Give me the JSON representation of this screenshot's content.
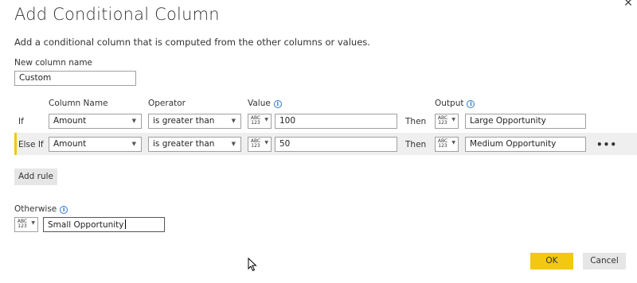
{
  "dialog": {
    "title": "Add Conditional Column",
    "description": "Add a conditional column that is computed from the other columns or values.",
    "close_glyph": "✕"
  },
  "new_column": {
    "label": "New column name",
    "value": "Custom"
  },
  "headers": {
    "column_name": "Column Name",
    "operator": "Operator",
    "value": "Value",
    "output": "Output"
  },
  "info_glyph": "i",
  "type_icon": {
    "top": "ABC",
    "bottom": "123"
  },
  "rules": [
    {
      "label": "If",
      "column": "Amount",
      "operator": "is greater than",
      "value": "100",
      "then": "Then",
      "output": "Large Opportunity"
    },
    {
      "label": "Else If",
      "column": "Amount",
      "operator": "is greater than",
      "value": "50",
      "then": "Then",
      "output": "Medium Opportunity",
      "more": "•••"
    }
  ],
  "add_rule": "Add rule",
  "otherwise": {
    "label": "Otherwise",
    "value": "Small Opportunity"
  },
  "buttons": {
    "ok": "OK",
    "cancel": "Cancel"
  },
  "colors": {
    "accent": "#f2c811",
    "info": "#2b7cd3",
    "row_highlight": "#efefef"
  }
}
